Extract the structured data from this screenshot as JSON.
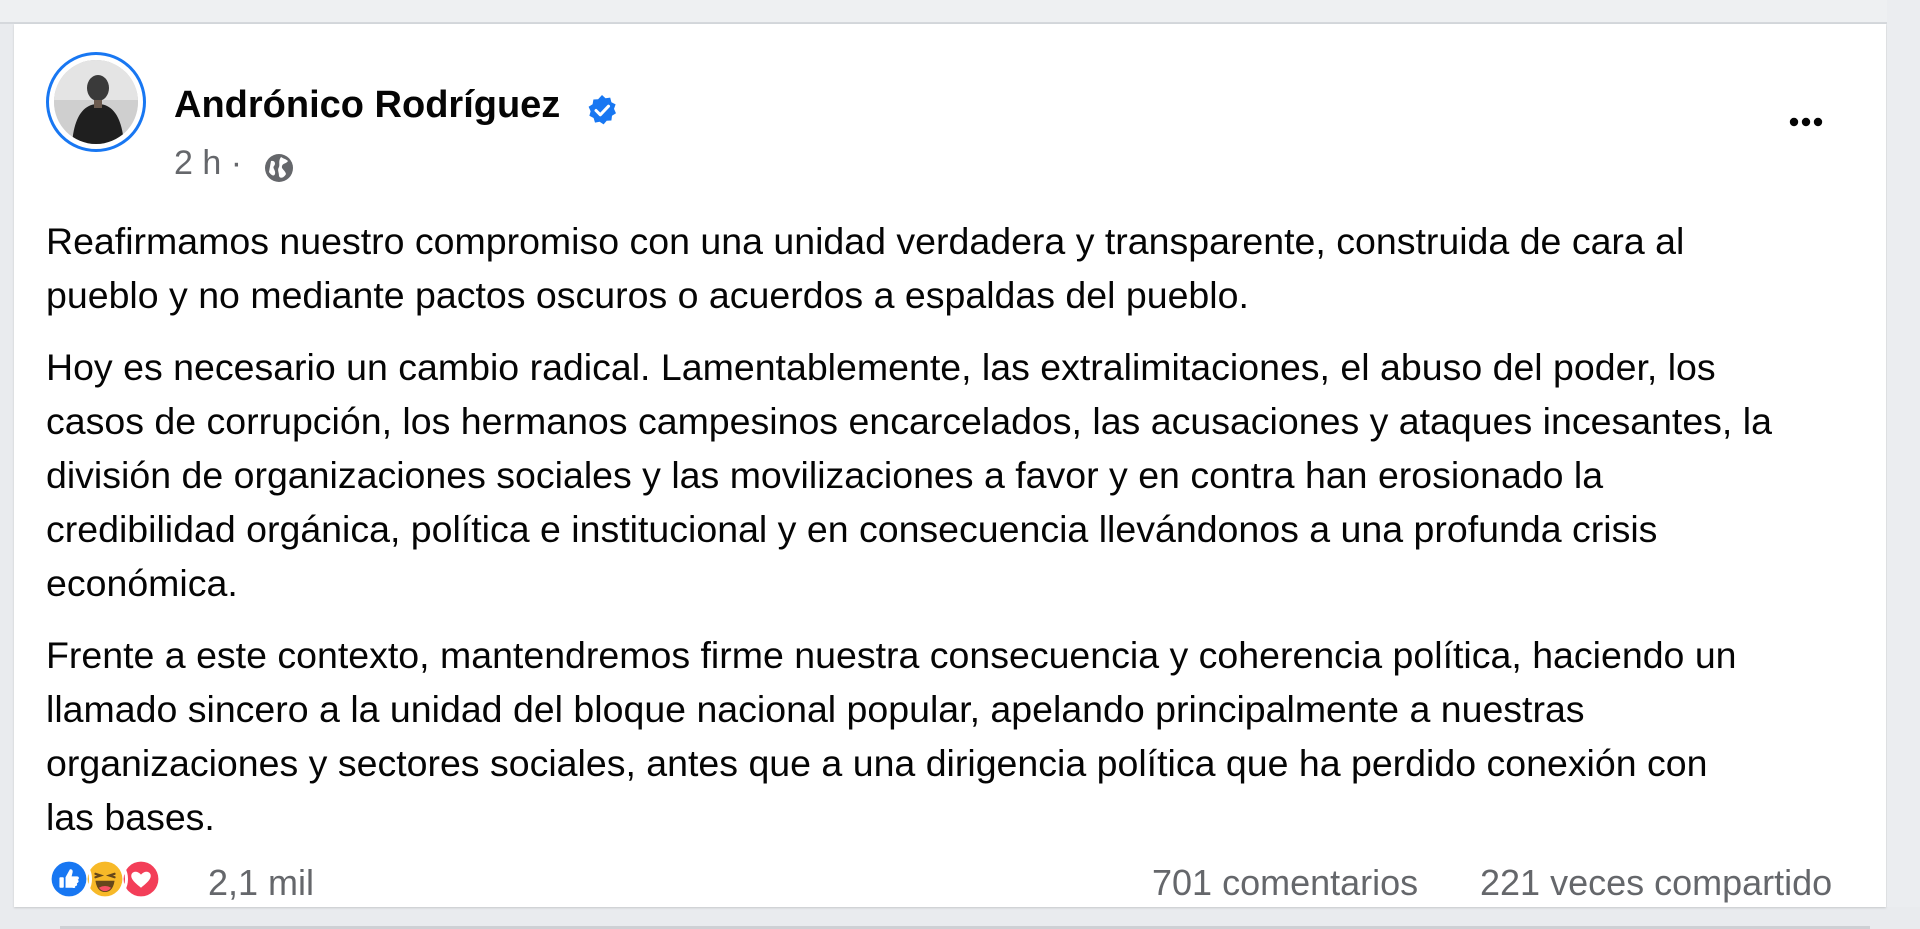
{
  "post": {
    "author": {
      "name": "Andrónico Rodríguez",
      "verified_icon": "verified-badge-icon",
      "avatar_icon": "avatar"
    },
    "timestamp": "2 h ·",
    "audience_icon": "globe-icon",
    "more_icon": "more-options-icon",
    "paragraphs": [
      "Reafirmamos nuestro compromiso con una unidad verdadera y transparente, construida de cara al\npueblo y no mediante pactos oscuros o acuerdos a espaldas del pueblo.",
      "Hoy es necesario un cambio radical. Lamentablemente, las extralimitaciones, el abuso del poder, los\ncasos de corrupción, los hermanos campesinos encarcelados, las acusaciones y ataques incesantes, la\ndivisión de organizaciones sociales y las movilizaciones a favor y en contra han erosionado la\ncredibilidad orgánica, política e institucional y en consecuencia llevándonos a una profunda crisis\neconómica.",
      "Frente a este contexto, mantendremos firme nuestra consecuencia y coherencia política, haciendo un\nllamado sincero a la unidad del bloque nacional popular, apelando principalmente a nuestras\norganizaciones y sectores sociales, antes que a una dirigencia política que ha perdido conexión con\nlas bases."
    ],
    "reactions": {
      "icons": [
        "like-icon",
        "haha-icon",
        "love-icon"
      ],
      "count": "2,1 mil"
    },
    "comments": "701 comentarios",
    "shares": "221 veces compartido"
  },
  "colors": {
    "accent": "#1877f2",
    "text": "#050505",
    "secondary_text": "#65676b",
    "love": "#f33e58",
    "haha": "#f7b928"
  }
}
